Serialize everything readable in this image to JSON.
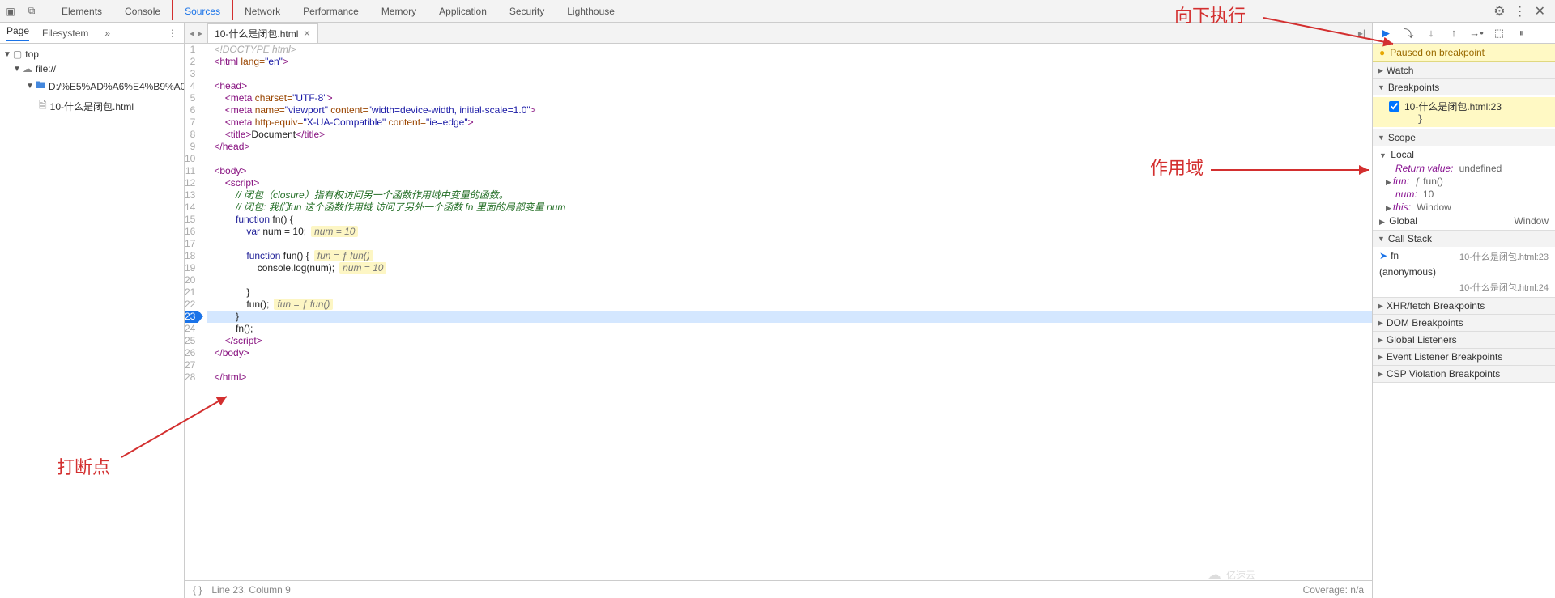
{
  "topbar": {
    "tabs": [
      "Elements",
      "Console",
      "Sources",
      "Network",
      "Performance",
      "Memory",
      "Application",
      "Security",
      "Lighthouse"
    ],
    "active_tab": "Sources"
  },
  "left": {
    "tabs": {
      "page": "Page",
      "filesystem": "Filesystem"
    },
    "tree": {
      "top": "top",
      "file_scheme": "file://",
      "folder": "D:/%E5%AD%A6%E4%B9%A0%",
      "file": "10-什么是闭包.html"
    }
  },
  "file_tab": {
    "name": "10-什么是闭包.html"
  },
  "gutter": {
    "lines": 28,
    "breakpoint_line": 23
  },
  "code": {
    "l1": "<!DOCTYPE html>",
    "l2a": "<html",
    "l2b": " lang=",
    "l2c": "\"en\"",
    "l2d": ">",
    "l4": "<head>",
    "l5a": "<meta",
    "l5b": " charset=",
    "l5c": "\"UTF-8\"",
    "l5d": ">",
    "l6a": "<meta",
    "l6b": " name=",
    "l6c": "\"viewport\"",
    "l6d": " content=",
    "l6e": "\"width=device-width, initial-scale=1.0\"",
    "l6f": ">",
    "l7a": "<meta",
    "l7b": " http-equiv=",
    "l7c": "\"X-UA-Compatible\"",
    "l7d": " content=",
    "l7e": "\"ie=edge\"",
    "l7f": ">",
    "l8a": "<title>",
    "l8b": "Document",
    "l8c": "</title>",
    "l9": "</head>",
    "l11": "<body>",
    "l12": "<script>",
    "l13": "// 闭包（closure）指有权访问另一个函数作用域中变量的函数。",
    "l14": "// 闭包: 我们fun 这个函数作用域 访问了另外一个函数 fn 里面的局部变量 num",
    "l15a": "function",
    "l15b": " fn() {",
    "l16a": "var",
    "l16b": " num = 10;",
    "l16badge": "num = 10",
    "l18a": "function",
    "l18b": " fun() {",
    "l18badge": "fun = ƒ fun()",
    "l19": "console.log(num);",
    "l19badge": "num = 10",
    "l21": "}",
    "l22": "fun();",
    "l22badge": "fun = ƒ fun()",
    "l23": "}",
    "l24": "fn();",
    "l25": "</script>",
    "l26": "</body>",
    "l28": "</html>"
  },
  "status": {
    "pos": "Line 23, Column 9",
    "coverage": "Coverage: n/a"
  },
  "debug": {
    "paused_msg": "Paused on breakpoint",
    "watch": "Watch",
    "breakpoints": "Breakpoints",
    "bp_label": "10-什么是闭包.html:23",
    "bp_snippet": "}",
    "scope": "Scope",
    "local": "Local",
    "return_key": "Return value:",
    "return_val": "undefined",
    "fun_key": "fun:",
    "fun_val": "ƒ fun()",
    "num_key": "num:",
    "num_val": "10",
    "this_key": "this:",
    "this_val": "Window",
    "global": "Global",
    "global_val": "Window",
    "call_stack": "Call Stack",
    "cs1": "fn",
    "cs1_loc": "10-什么是闭包.html:23",
    "cs2": "(anonymous)",
    "cs2_loc": "10-什么是闭包.html:24",
    "xhr": "XHR/fetch Breakpoints",
    "dom": "DOM Breakpoints",
    "listeners": "Global Listeners",
    "event": "Event Listener Breakpoints",
    "csp": "CSP Violation Breakpoints"
  },
  "annot": {
    "a1": "向下执行",
    "a2": "作用域",
    "a3": "打断点"
  },
  "watermark": "亿速云"
}
